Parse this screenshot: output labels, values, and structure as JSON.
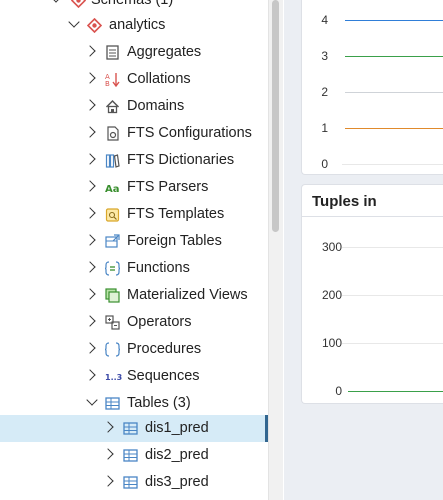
{
  "tree": {
    "schemas_partial": "Schemas (1)",
    "schema": "analytics",
    "items": [
      {
        "label": "Aggregates",
        "icon": "aggregate-icon"
      },
      {
        "label": "Collations",
        "icon": "collation-icon"
      },
      {
        "label": "Domains",
        "icon": "domain-icon"
      },
      {
        "label": "FTS Configurations",
        "icon": "fts-configuration-icon"
      },
      {
        "label": "FTS Dictionaries",
        "icon": "fts-dictionary-icon"
      },
      {
        "label": "FTS Parsers",
        "icon": "fts-parser-icon"
      },
      {
        "label": "FTS Templates",
        "icon": "fts-template-icon"
      },
      {
        "label": "Foreign Tables",
        "icon": "foreign-table-icon"
      },
      {
        "label": "Functions",
        "icon": "function-icon"
      },
      {
        "label": "Materialized Views",
        "icon": "materialized-view-icon"
      },
      {
        "label": "Operators",
        "icon": "operator-icon"
      },
      {
        "label": "Procedures",
        "icon": "procedure-icon"
      },
      {
        "label": "Sequences",
        "icon": "sequence-icon"
      },
      {
        "label": "Tables",
        "icon": "table-icon",
        "count": "(3)"
      }
    ],
    "tables": [
      "dis1_pred",
      "dis2_pred",
      "dis3_pred"
    ],
    "selected": "dis1_pred"
  },
  "dashboard": {
    "top_chart": {
      "y_ticks": [
        "4",
        "3",
        "2",
        "1",
        "0"
      ],
      "series_colors": [
        "#2f7ed8",
        "#3aa04a",
        "#cfd3d8",
        "#e08a2c"
      ]
    },
    "tuples_in": {
      "title": "Tuples in",
      "y_ticks": [
        "300",
        "200",
        "100",
        "0"
      ],
      "series_color": "#3aa04a"
    }
  }
}
